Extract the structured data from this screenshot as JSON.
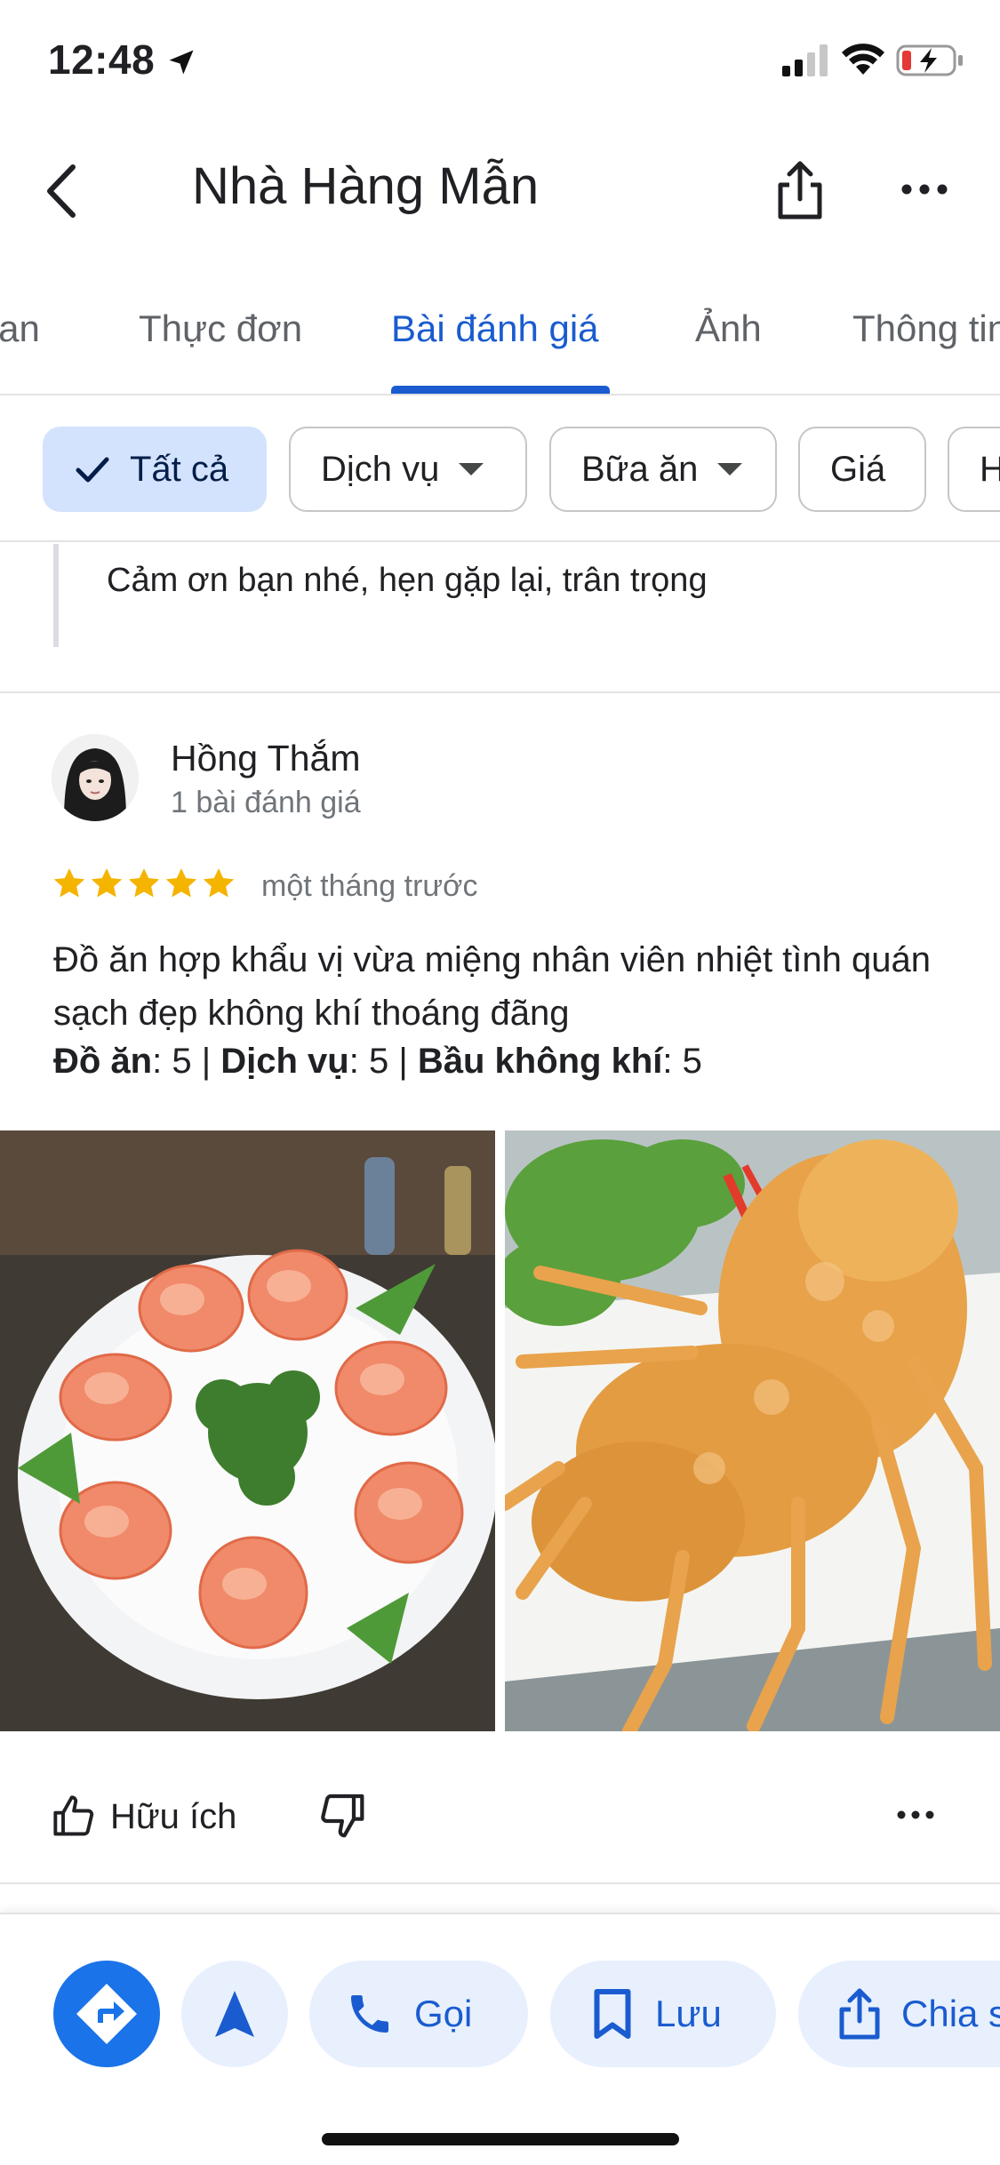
{
  "status_bar": {
    "time": "12:48"
  },
  "header": {
    "title": "Nhà Hàng Mẫn"
  },
  "tabs": [
    {
      "label": "Tổng quan"
    },
    {
      "label": "Thực đơn"
    },
    {
      "label": "Bài đánh giá"
    },
    {
      "label": "Ảnh"
    },
    {
      "label": "Thông tin"
    }
  ],
  "tabs_active_index": 2,
  "filters": [
    {
      "label": "Tất cả",
      "selected": true
    },
    {
      "label": "Dịch vụ",
      "dropdown": true
    },
    {
      "label": "Bữa ăn",
      "dropdown": true
    },
    {
      "label": "Giá"
    },
    {
      "label": "H"
    }
  ],
  "owner_reply": {
    "text": "Cảm ơn bạn nhé,  hẹn gặp lại,  trân trọng"
  },
  "review": {
    "author": "Hồng Thắm",
    "author_review_count": "1 bài đánh giá",
    "rating": 5,
    "time": "một tháng trước",
    "text": "Đồ ăn hợp khẩu vị vừa miệng nhân viên nhiệt tình quán sạch đẹp không khí thoáng đãng",
    "ratings": {
      "food_label": "Đồ ăn",
      "food_value": "5",
      "service_label": "Dịch vụ",
      "service_value": "5",
      "atmosphere_label": "Bầu không khí",
      "atmosphere_value": "5"
    },
    "helpful_label": "Hữu ích"
  },
  "bottom_bar": {
    "call_label": "Gọi",
    "save_label": "Lưu",
    "share_label": "Chia sẻ"
  },
  "colors": {
    "accent": "#1a5ccf",
    "primary_button": "#1a73e8",
    "chip_selected": "#d3e3fd",
    "star": "#f5b400",
    "secondary_text": "#70757a"
  }
}
